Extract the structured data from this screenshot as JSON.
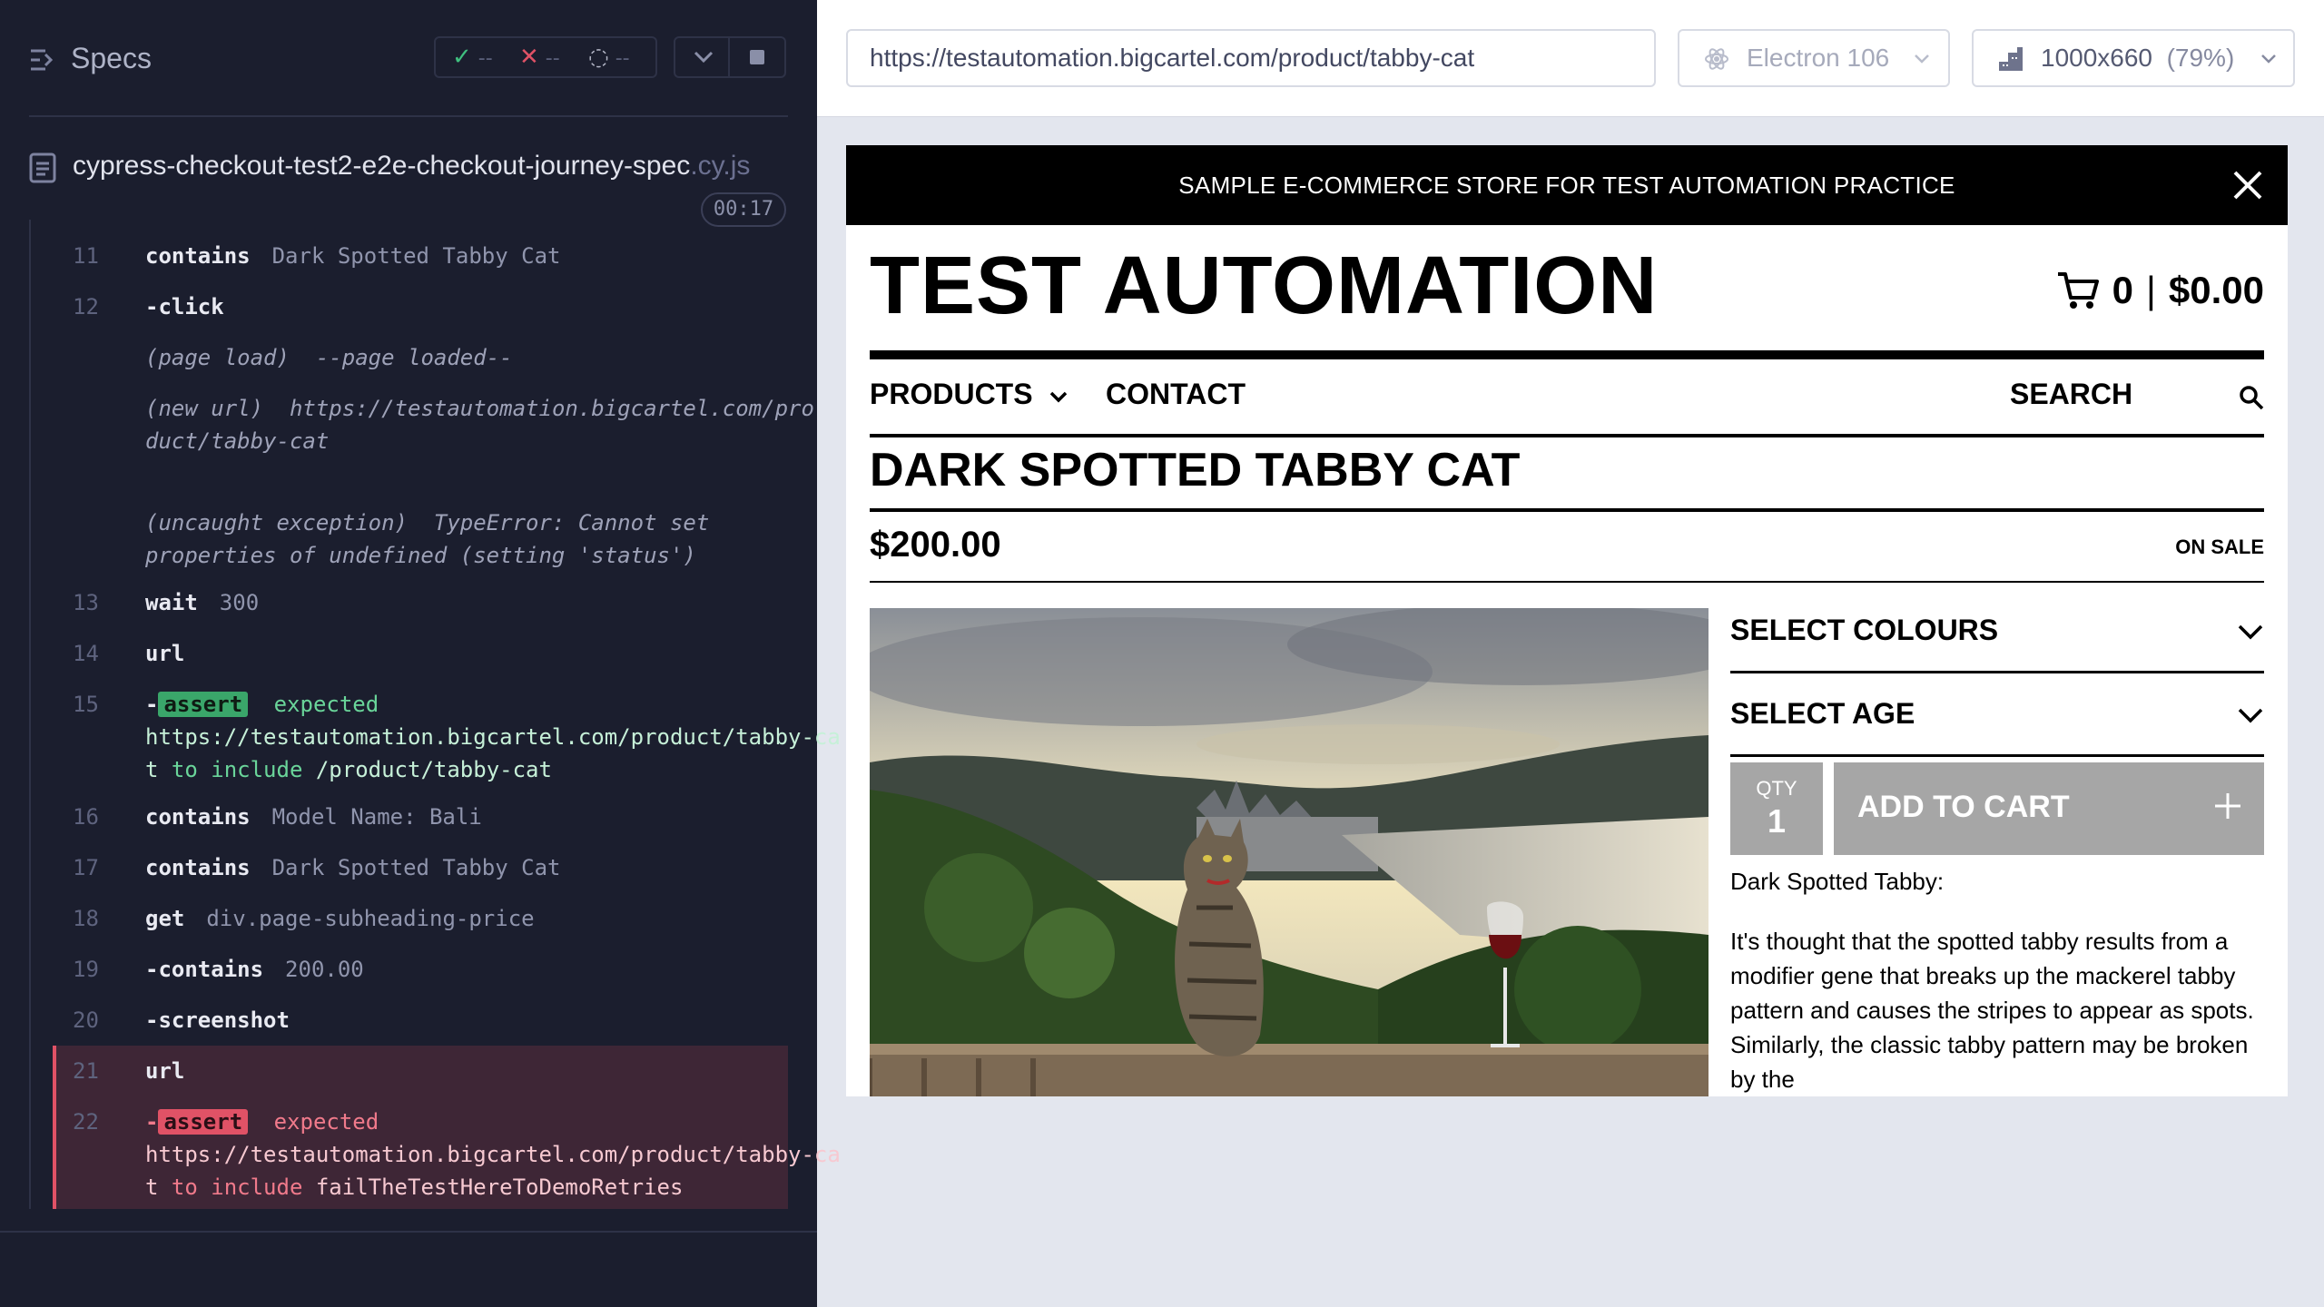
{
  "reporter": {
    "title": "Specs",
    "stats": {
      "passed": "--",
      "failed": "--",
      "pending": "--"
    },
    "spec": {
      "name": "cypress-checkout-test2-e2e-checkout-journey-spec",
      "ext": ".cy.js",
      "duration": "00:17"
    },
    "commands": [
      {
        "n": "11",
        "name": "contains",
        "arg": "Dark Spotted Tabby Cat"
      },
      {
        "n": "12",
        "name": "-click",
        "arg": ""
      },
      {
        "n": "",
        "event": "(page load)",
        "msg": "--page loaded--"
      },
      {
        "n": "",
        "event": "(new url)",
        "msg": "https://testautomation.bigcartel.com/product/tabby-cat"
      },
      {
        "n": "",
        "event": "(uncaught exception)",
        "msg": "TypeError: Cannot set properties of undefined (setting 'status')"
      },
      {
        "n": "13",
        "name": "wait",
        "arg": "300"
      },
      {
        "n": "14",
        "name": "url",
        "arg": ""
      },
      {
        "n": "15",
        "assert": "assert",
        "expected": "expected",
        "url": "https://testautomation.bigcartel.com/product/tabby-cat",
        "to": "to include",
        "value": "/product/tabby-cat"
      },
      {
        "n": "16",
        "name": "contains",
        "arg": "Model Name: Bali"
      },
      {
        "n": "17",
        "name": "contains",
        "arg": "Dark Spotted Tabby Cat"
      },
      {
        "n": "18",
        "name": "get",
        "arg": "div.page-subheading-price"
      },
      {
        "n": "19",
        "name": "-contains",
        "arg": "200.00"
      },
      {
        "n": "20",
        "name": "-screenshot",
        "arg": ""
      },
      {
        "n": "21",
        "name": "url",
        "arg": ""
      },
      {
        "n": "22",
        "assert": "assert",
        "expected": "expected",
        "url": "https://testautomation.bigcartel.com/product/tabby-cat",
        "to": "to include",
        "value": "failTheTestHereToDemoRetries"
      }
    ]
  },
  "aut": {
    "url": "https://testautomation.bigcartel.com/product/tabby-cat",
    "browser": "Electron 106",
    "viewport": "1000x660",
    "scale": "(79%)"
  },
  "store": {
    "banner": "SAMPLE E-COMMERCE STORE FOR TEST AUTOMATION PRACTICE",
    "brand": "TEST AUTOMATION",
    "cart_count": "0",
    "cart_total": "$0.00",
    "nav": {
      "products": "PRODUCTS",
      "contact": "CONTACT",
      "search": "SEARCH"
    },
    "product": {
      "title": "DARK SPOTTED TABBY CAT",
      "price": "$200.00",
      "status": "ON SALE",
      "option_colours": "SELECT COLOURS",
      "option_age": "SELECT AGE",
      "qty_label": "QTY",
      "qty_value": "1",
      "add_to_cart": "ADD TO CART",
      "desc_title": "Dark Spotted Tabby:",
      "desc_body": "It's thought that the spotted tabby results from a modifier gene that breaks up the mackerel tabby pattern and causes the stripes to appear as spots. Similarly, the classic tabby pattern may be broken by the"
    }
  }
}
